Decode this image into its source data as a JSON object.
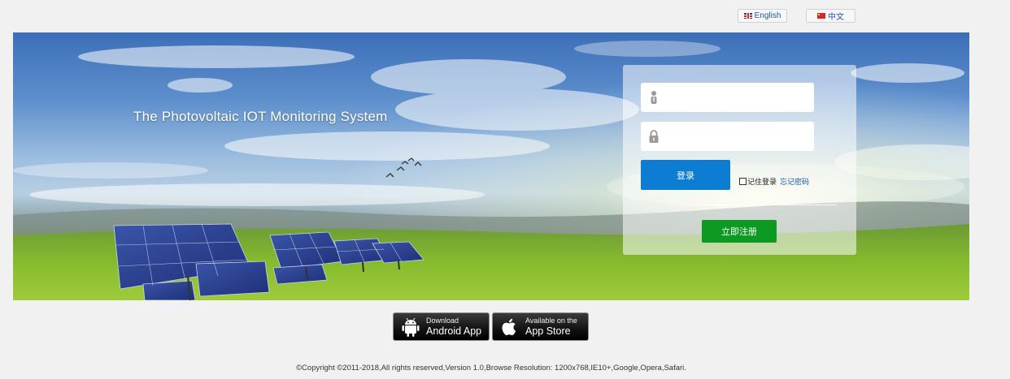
{
  "language": {
    "english_label": "English",
    "chinese_label": "中文"
  },
  "banner": {
    "title": "The Photovoltaic IOT Monitoring System"
  },
  "login": {
    "username_placeholder": "",
    "password_placeholder": "",
    "login_button": "登录",
    "remember_label": "记住登录",
    "forgot_link": "忘记密码",
    "register_button": "立即注册"
  },
  "apps": {
    "android": {
      "small": "Download",
      "large": "Android App"
    },
    "apple": {
      "small": "Available on the",
      "large": "App Store"
    }
  },
  "footer": {
    "copyright": "©Copyright ©2011-2018,All rights reserved,Version 1.0,Browse Resolution: 1200x768,IE10+,Google,Opera,Safari."
  },
  "colors": {
    "login_button": "#0d7dd4",
    "register_button": "#0c9a22",
    "link": "#1a5aa0"
  }
}
